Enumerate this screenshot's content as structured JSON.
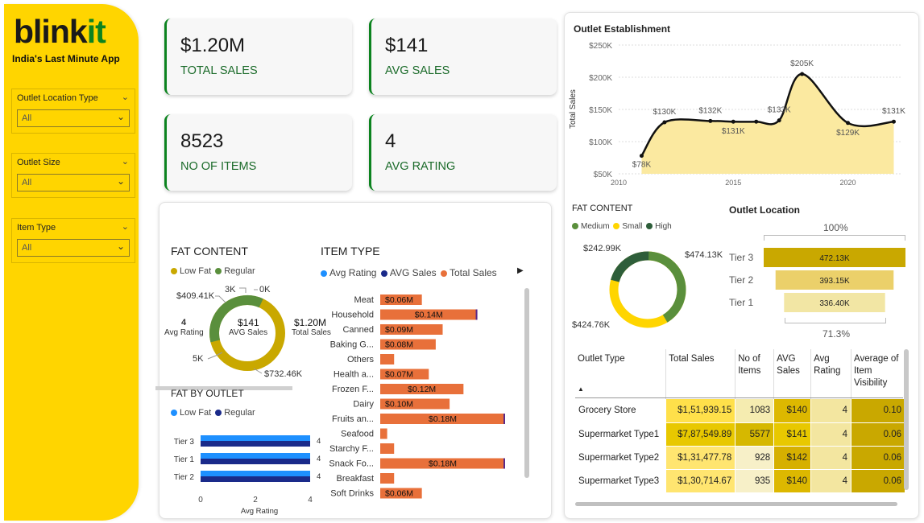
{
  "brand": {
    "part1": "blink",
    "part2": "it",
    "tagline": "India's Last Minute App"
  },
  "filters": [
    {
      "title": "Outlet Location Type",
      "value": "All"
    },
    {
      "title": "Outlet Size",
      "value": "All"
    },
    {
      "title": "Item Type",
      "value": "All"
    }
  ],
  "kpis": [
    {
      "value": "$1.20M",
      "label": "TOTAL SALES"
    },
    {
      "value": "$141",
      "label": "AVG SALES"
    },
    {
      "value": "8523",
      "label": "NO OF ITEMS"
    },
    {
      "value": "4",
      "label": "AVG RATING"
    }
  ],
  "fat_content": {
    "title": "FAT CONTENT",
    "legend": [
      "Low Fat",
      "Regular"
    ],
    "labels": {
      "l1": "$409.41K",
      "l2": "3K",
      "l3": "0K",
      "l4": "4",
      "l5": "Avg Rating",
      "l6": "$141",
      "l7": "AVG Sales",
      "l8": "$1.20M",
      "l9": "Total Sales",
      "l10": "5K",
      "l11": "$732.46K"
    }
  },
  "fat_by_outlet": {
    "title": "FAT BY OUTLET",
    "legend": [
      "Low Fat",
      "Regular"
    ],
    "xlabel": "Avg Rating",
    "ticks": [
      "0",
      "2",
      "4"
    ]
  },
  "item_type": {
    "title": "ITEM TYPE",
    "legend": [
      "Avg Rating",
      "AVG Sales",
      "Total Sales"
    ]
  },
  "outlet_est": {
    "title": "Outlet Establishment",
    "ylabel": "Total Sales"
  },
  "fat_content_2": {
    "title": "FAT CONTENT",
    "legend": [
      "Medium",
      "Small",
      "High"
    ],
    "labels": [
      "$242.99K",
      "$474.13K",
      "$424.76K"
    ]
  },
  "outlet_location": {
    "title": "Outlet Location",
    "top": "100%",
    "bottom": "71.3%"
  },
  "table": {
    "headers": [
      "Outlet Type",
      "Total Sales",
      "No of Items",
      "AVG Sales",
      "Avg Rating",
      "Average of Item Visibility"
    ],
    "rows": [
      [
        "Grocery Store",
        "$1,51,939.15",
        "1083",
        "$140",
        "4",
        "0.10"
      ],
      [
        "Supermarket Type1",
        "$7,87,549.89",
        "5577",
        "$141",
        "4",
        "0.06"
      ],
      [
        "Supermarket Type2",
        "$1,31,477.78",
        "928",
        "$142",
        "4",
        "0.06"
      ],
      [
        "Supermarket Type3",
        "$1,30,714.67",
        "935",
        "$140",
        "4",
        "0.06"
      ]
    ]
  },
  "colors": {
    "brand_yellow": "#ffd500",
    "brand_green": "#0c831f",
    "orange": "#e8703a",
    "gold": "#c9a800",
    "navy": "#1a2a8a",
    "blue": "#1e90ff"
  },
  "chart_data": [
    {
      "type": "line",
      "title": "Outlet Establishment",
      "ylabel": "Total Sales",
      "x": [
        2011,
        2012,
        2014,
        2015,
        2016,
        2017,
        2018,
        2020,
        2022
      ],
      "y": [
        78,
        130,
        132,
        131,
        131,
        133,
        205,
        129,
        131
      ],
      "point_labels": [
        "$78K",
        "$130K",
        "$132K",
        "$131K",
        "",
        "$133K",
        "$205K",
        "$129K",
        "$131K"
      ],
      "xticks": [
        "2010",
        "2015",
        "2020"
      ],
      "yticks": [
        "$50K",
        "$100K",
        "$150K",
        "$200K",
        "$250K"
      ],
      "ylim": [
        50,
        250
      ]
    },
    {
      "type": "bar",
      "title": "ITEM TYPE",
      "categories": [
        "Meat",
        "Household",
        "Canned",
        "Baking G...",
        "Others",
        "Health a...",
        "Frozen F...",
        "Dairy",
        "Fruits an...",
        "Seafood",
        "Starchy F...",
        "Snack Fo...",
        "Breakfast",
        "Soft Drinks"
      ],
      "values": [
        0.06,
        0.14,
        0.09,
        0.08,
        0.02,
        0.07,
        0.12,
        0.1,
        0.18,
        0.01,
        0.02,
        0.18,
        0.02,
        0.06
      ],
      "value_labels": [
        "$0.06M",
        "$0.14M",
        "$0.09M",
        "$0.08M",
        "",
        "$0.07M",
        "$0.12M",
        "$0.10M",
        "$0.18M",
        "",
        "",
        "$0.18M",
        "",
        "$0.06M"
      ]
    },
    {
      "type": "bar",
      "title": "FAT BY OUTLET",
      "categories": [
        "Tier 3",
        "Tier 1",
        "Tier 2"
      ],
      "series": [
        {
          "name": "Low Fat",
          "values": [
            4,
            4,
            4
          ]
        },
        {
          "name": "Regular",
          "values": [
            4,
            4,
            4
          ]
        }
      ],
      "value_labels": [
        "4",
        "4",
        "4"
      ],
      "xlim": [
        0,
        4
      ]
    },
    {
      "type": "bar",
      "title": "Outlet Location",
      "categories": [
        "Tier 3",
        "Tier 2",
        "Tier 1"
      ],
      "values": [
        472.13,
        393.15,
        336.4
      ],
      "value_labels": [
        "472.13K",
        "393.15K",
        "336.40K"
      ]
    },
    {
      "type": "pie",
      "title": "FAT CONTENT",
      "categories": [
        "Low Fat",
        "Regular"
      ],
      "values": [
        732.46,
        409.41
      ]
    },
    {
      "type": "pie",
      "title": "FAT CONTENT",
      "categories": [
        "Medium",
        "Small",
        "High"
      ],
      "values": [
        474.13,
        424.76,
        242.99
      ]
    }
  ]
}
